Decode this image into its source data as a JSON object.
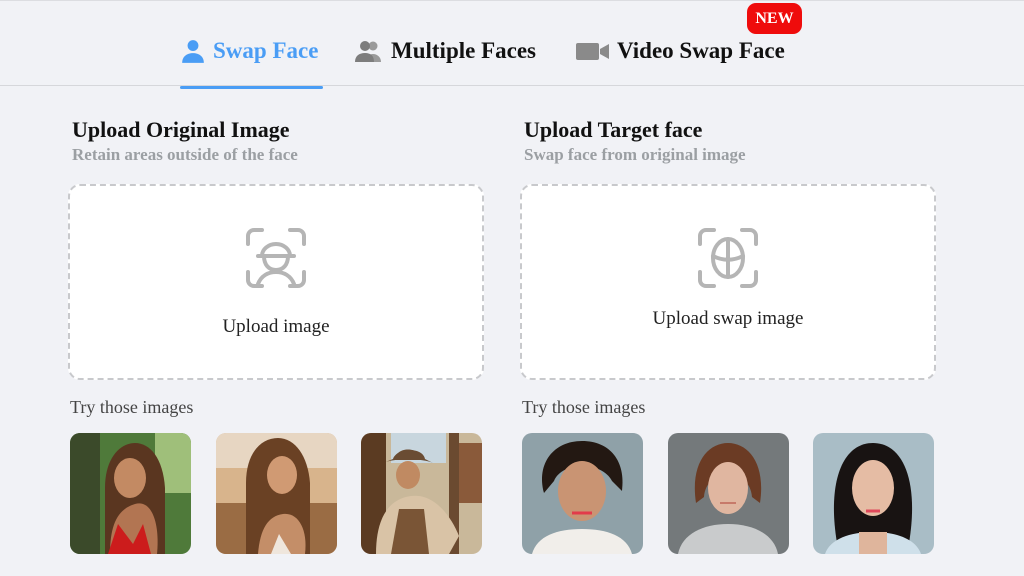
{
  "tabs": [
    {
      "label": "Swap Face",
      "icon": "user-icon",
      "active": true
    },
    {
      "label": "Multiple Faces",
      "icon": "users-icon",
      "active": false
    },
    {
      "label": "Video Swap Face",
      "icon": "video-camera-icon",
      "active": false,
      "badge": "NEW"
    }
  ],
  "colors": {
    "accent": "#4a9df5",
    "badge": "#ef0c0c",
    "subtitle": "#9b9fa3"
  },
  "original": {
    "title": "Upload Original Image",
    "subtitle": "Retain areas outside of the face",
    "upload_label": "Upload image",
    "icon": "face-scan-icon",
    "try_label": "Try those images",
    "samples": [
      {
        "description": "woman with long hair in red top, tropical garden"
      },
      {
        "description": "woman with wavy hair in sunlight, beach dunes"
      },
      {
        "description": "cowboy in hat leaning on post, western town"
      }
    ]
  },
  "target": {
    "title": "Upload Target face",
    "subtitle": "Swap face from original image",
    "upload_label": "Upload swap image",
    "icon": "face-grid-scan-icon",
    "try_label": "Try those images",
    "samples": [
      {
        "description": "man with curly dark hair, white t-shirt"
      },
      {
        "description": "young woman with auburn hair, grey sweater"
      },
      {
        "description": "woman with long black hair, light top"
      }
    ]
  }
}
